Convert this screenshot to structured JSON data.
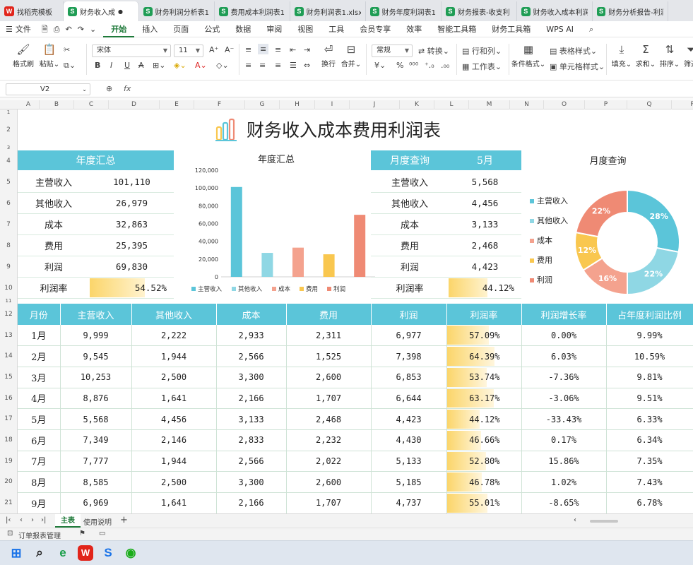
{
  "file_tabs": [
    {
      "label": "找稻壳模板",
      "icon": "wps"
    },
    {
      "label": "财务收入成",
      "icon": "sheet",
      "active": true
    },
    {
      "label": "财务利润分析表1.",
      "icon": "sheet"
    },
    {
      "label": "费用成本利润表1.",
      "icon": "sheet"
    },
    {
      "label": "财务利润表1.xlsx",
      "icon": "sheet"
    },
    {
      "label": "财务年度利润表1.",
      "icon": "sheet"
    },
    {
      "label": "财务报表-收支利",
      "icon": "sheet"
    },
    {
      "label": "财务收入成本利润",
      "icon": "sheet"
    },
    {
      "label": "财务分析报告-利润",
      "icon": "sheet"
    }
  ],
  "menu": {
    "file": "文件",
    "items": [
      "开始",
      "插入",
      "页面",
      "公式",
      "数据",
      "审阅",
      "视图",
      "工具",
      "会员专享",
      "效率",
      "智能工具箱",
      "财务工具箱",
      "WPS AI"
    ],
    "active": "开始"
  },
  "toolbar": {
    "format_painter": "格式刷",
    "paste": "粘贴",
    "font": "宋体",
    "font_size": "11",
    "wrap": "换行",
    "merge": "合并",
    "number_format": "常规",
    "convert": "转换",
    "rows_cols": "行和列",
    "worksheet": "工作表",
    "cond_format": "条件格式",
    "table_style": "表格样式",
    "cell_style": "单元格样式",
    "fill": "填充",
    "sum": "求和",
    "sort": "排序",
    "filter": "筛选"
  },
  "formula_bar": {
    "cell_ref": "V2",
    "fx": "fx"
  },
  "columns": [
    "A",
    "B",
    "C",
    "D",
    "E",
    "F",
    "G",
    "H",
    "I",
    "J",
    "K",
    "L",
    "M",
    "N",
    "O",
    "P",
    "Q",
    "R"
  ],
  "rows": [
    "1",
    "2",
    "3",
    "4",
    "5",
    "6",
    "7",
    "8",
    "9",
    "10",
    "11",
    "12",
    "13",
    "14",
    "15",
    "16",
    "17",
    "18",
    "19",
    "20",
    "21"
  ],
  "sheet_title": "财务收入成本费用利润表",
  "annual_summary": {
    "header": "年度汇总",
    "rows": [
      {
        "label": "主营收入",
        "value": "101,110"
      },
      {
        "label": "其他收入",
        "value": "26,979"
      },
      {
        "label": "成本",
        "value": "32,863"
      },
      {
        "label": "费用",
        "value": "25,395"
      },
      {
        "label": "利润",
        "value": "69,830"
      }
    ],
    "margin_label": "利润率",
    "margin_value": "54.52%",
    "margin_fraction": 0.5452
  },
  "monthly_query": {
    "header": "月度查询",
    "month": "5月",
    "rows": [
      {
        "label": "主营收入",
        "value": "5,568"
      },
      {
        "label": "其他收入",
        "value": "4,456"
      },
      {
        "label": "成本",
        "value": "3,133"
      },
      {
        "label": "费用",
        "value": "2,468"
      },
      {
        "label": "利润",
        "value": "4,423"
      }
    ],
    "margin_label": "利润率",
    "margin_value": "44.12%",
    "margin_fraction": 0.4412
  },
  "chart_data": [
    {
      "type": "bar",
      "title": "年度汇总",
      "categories": [
        "主营收入",
        "其他收入",
        "成本",
        "费用",
        "利润"
      ],
      "values": [
        101110,
        26979,
        32863,
        25395,
        69830
      ],
      "colors": [
        "#5bc5d9",
        "#8fd7e4",
        "#f4a28e",
        "#f9c74f",
        "#ef8a74"
      ],
      "ylim": [
        0,
        120000
      ],
      "yticks": [
        "0",
        "20,000",
        "40,000",
        "60,000",
        "80,000",
        "100,000",
        "120,000"
      ],
      "legend": "bottom"
    },
    {
      "type": "pie",
      "title": "月度查询",
      "categories": [
        "主营收入",
        "其他收入",
        "成本",
        "费用",
        "利润"
      ],
      "values": [
        28,
        22,
        16,
        12,
        22
      ],
      "labels": [
        "28%",
        "22%",
        "16%",
        "12%",
        "22%"
      ],
      "colors": [
        "#5bc5d9",
        "#8fd7e4",
        "#f4a28e",
        "#f9c74f",
        "#ef8a74"
      ],
      "legend": "left"
    }
  ],
  "main_table": {
    "headers": [
      "月份",
      "主营收入",
      "其他收入",
      "成本",
      "费用",
      "利润",
      "利润率",
      "利润增长率",
      "占年度利润比例"
    ],
    "rows": [
      [
        "1月",
        "9,999",
        "2,222",
        "2,933",
        "2,311",
        "6,977",
        "57.09%",
        "0.00%",
        "9.99%"
      ],
      [
        "2月",
        "9,545",
        "1,944",
        "2,566",
        "1,525",
        "7,398",
        "64.39%",
        "6.03%",
        "10.59%"
      ],
      [
        "3月",
        "10,253",
        "2,500",
        "3,300",
        "2,600",
        "6,853",
        "53.74%",
        "-7.36%",
        "9.81%"
      ],
      [
        "4月",
        "8,876",
        "1,641",
        "2,166",
        "1,707",
        "6,644",
        "63.17%",
        "-3.06%",
        "9.51%"
      ],
      [
        "5月",
        "5,568",
        "4,456",
        "3,133",
        "2,468",
        "4,423",
        "44.12%",
        "-33.43%",
        "6.33%"
      ],
      [
        "6月",
        "7,349",
        "2,146",
        "2,833",
        "2,232",
        "4,430",
        "46.66%",
        "0.17%",
        "6.34%"
      ],
      [
        "7月",
        "7,777",
        "1,944",
        "2,566",
        "2,022",
        "5,133",
        "52.80%",
        "15.86%",
        "7.35%"
      ],
      [
        "8月",
        "8,585",
        "2,500",
        "3,300",
        "2,600",
        "5,185",
        "46.78%",
        "1.02%",
        "7.43%"
      ],
      [
        "9月",
        "6,969",
        "1,641",
        "2,166",
        "1,707",
        "4,737",
        "55.01%",
        "-8.65%",
        "6.78%"
      ]
    ],
    "margin_fractions": [
      0.5709,
      0.6439,
      0.5374,
      0.6317,
      0.4412,
      0.4666,
      0.528,
      0.4678,
      0.5501
    ]
  },
  "sheet_tabs": [
    "主表",
    "使用说明"
  ],
  "active_sheet": "主表",
  "status": {
    "left": "订单报表管理"
  }
}
